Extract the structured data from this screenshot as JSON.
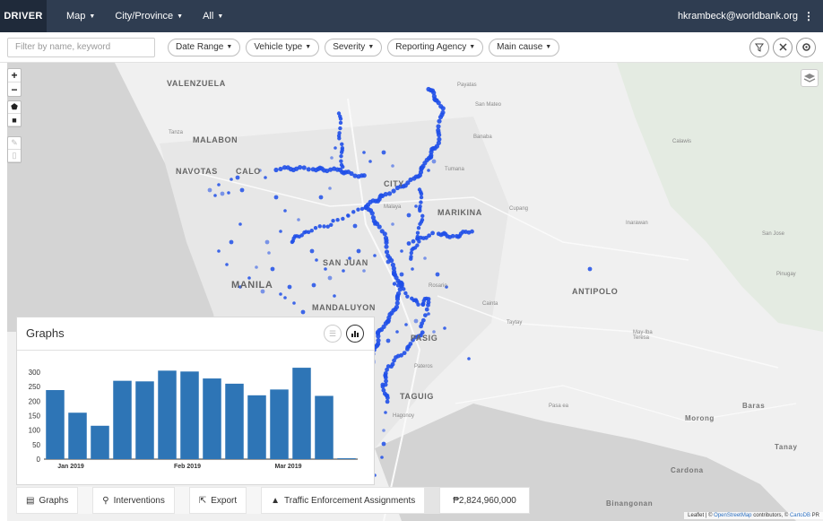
{
  "nav": {
    "brand": "DRIVER",
    "items": [
      {
        "label": "Map"
      },
      {
        "label": "City/Province"
      },
      {
        "label": "All"
      }
    ],
    "user": "hkrambeck@worldbank.org"
  },
  "filters": {
    "search_placeholder": "Filter by name, keyword",
    "pills": [
      {
        "label": "Date Range"
      },
      {
        "label": "Vehicle type"
      },
      {
        "label": "Severity"
      },
      {
        "label": "Reporting Agency"
      },
      {
        "label": "Main cause"
      }
    ]
  },
  "map": {
    "labels": [
      {
        "text": "VALENZUELA"
      },
      {
        "text": "MALABON"
      },
      {
        "text": "NAVOTAS"
      },
      {
        "text": "CALO"
      },
      {
        "text": "CITY"
      },
      {
        "text": "MARIKINA"
      },
      {
        "text": "MANILA"
      },
      {
        "text": "SAN JUAN"
      },
      {
        "text": "MANDALUYON"
      },
      {
        "text": "PASIG"
      },
      {
        "text": "TAGUIG"
      },
      {
        "text": "ANTIPOLO"
      }
    ],
    "small_labels": [
      {
        "text": "Payatas"
      },
      {
        "text": "San Mateo"
      },
      {
        "text": "Banaba"
      },
      {
        "text": "Tumana"
      },
      {
        "text": "Cupang"
      },
      {
        "text": "Calawis"
      },
      {
        "text": "San Jose"
      },
      {
        "text": "Pinugay"
      },
      {
        "text": "Cainta"
      },
      {
        "text": "Taytay"
      },
      {
        "text": "May-Iba Teresa"
      },
      {
        "text": "Pateros"
      },
      {
        "text": "Hagonoy"
      },
      {
        "text": "Pasa ea"
      },
      {
        "text": "Morong"
      },
      {
        "text": "Baras"
      },
      {
        "text": "Tanay"
      },
      {
        "text": "Cardona"
      },
      {
        "text": "Binangonan"
      },
      {
        "text": "Tanza"
      },
      {
        "text": "Malaya"
      },
      {
        "text": "Rosario"
      },
      {
        "text": "Inarawan"
      }
    ],
    "dot_color": "#1f4fe8",
    "attribution": {
      "prefix": "Leaflet | ©",
      "link": "OpenStreetMap",
      "suffix": "contributors, ©",
      "link2": "CartoDB",
      "tail": "PR"
    }
  },
  "graphs": {
    "title": "Graphs"
  },
  "chart_data": {
    "type": "bar",
    "bar_color": "#2e75b6",
    "values": [
      238,
      160,
      115,
      270,
      268,
      305,
      302,
      278,
      260,
      220,
      240,
      315,
      218,
      3
    ],
    "y_ticks": [
      "0",
      "50",
      "100",
      "150",
      "200",
      "250",
      "300"
    ],
    "ylim": [
      0,
      340
    ],
    "x_tick_labels": [
      {
        "label": "Jan 2019",
        "at_bar": 0.7
      },
      {
        "label": "Feb 2019",
        "at_bar": 5.9
      },
      {
        "label": "Mar 2019",
        "at_bar": 10.4
      }
    ]
  },
  "bottom": {
    "tabs": [
      {
        "icon": "table-icon",
        "glyph": "▤",
        "label": "Graphs"
      },
      {
        "icon": "map-marker-icon",
        "glyph": "⚲",
        "label": "Interventions"
      },
      {
        "icon": "export-icon",
        "glyph": "⇱",
        "label": "Export"
      },
      {
        "icon": "user-icon",
        "glyph": "👤",
        "label": "Traffic Enforcement Assignments"
      }
    ],
    "cost": "₱2,824,960,000"
  }
}
